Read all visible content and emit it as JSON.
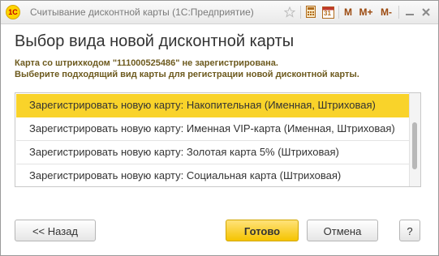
{
  "window": {
    "title": "Считывание дисконтной карты  (1С:Предприятие)",
    "logo_text": "1С",
    "toolbar": {
      "m_label": "M",
      "m_plus_label": "M+",
      "m_minus_label": "M-",
      "calendar_day": "31"
    }
  },
  "heading": "Выбор вида новой дисконтной карты",
  "message": {
    "line1": "Карта со штрихкодом \"111000525486\" не зарегистрирована.",
    "line2": "Выберите подходящий вид карты для регистрации новой дисконтной карты."
  },
  "list": {
    "items": [
      "Зарегистрировать новую карту: Накопительная (Именная, Штриховая)",
      "Зарегистрировать новую карту: Именная VIP-карта (Именная, Штриховая)",
      "Зарегистрировать новую карту: Золотая карта 5% (Штриховая)",
      "Зарегистрировать новую карту: Социальная карта (Штриховая)"
    ],
    "selected_index": 0
  },
  "buttons": {
    "back": "<< Назад",
    "done": "Готово",
    "cancel": "Отмена",
    "help": "?"
  },
  "colors": {
    "selection": "#f9d32a",
    "primary_button": "#f5c400",
    "message_text": "#6d5a1e"
  }
}
